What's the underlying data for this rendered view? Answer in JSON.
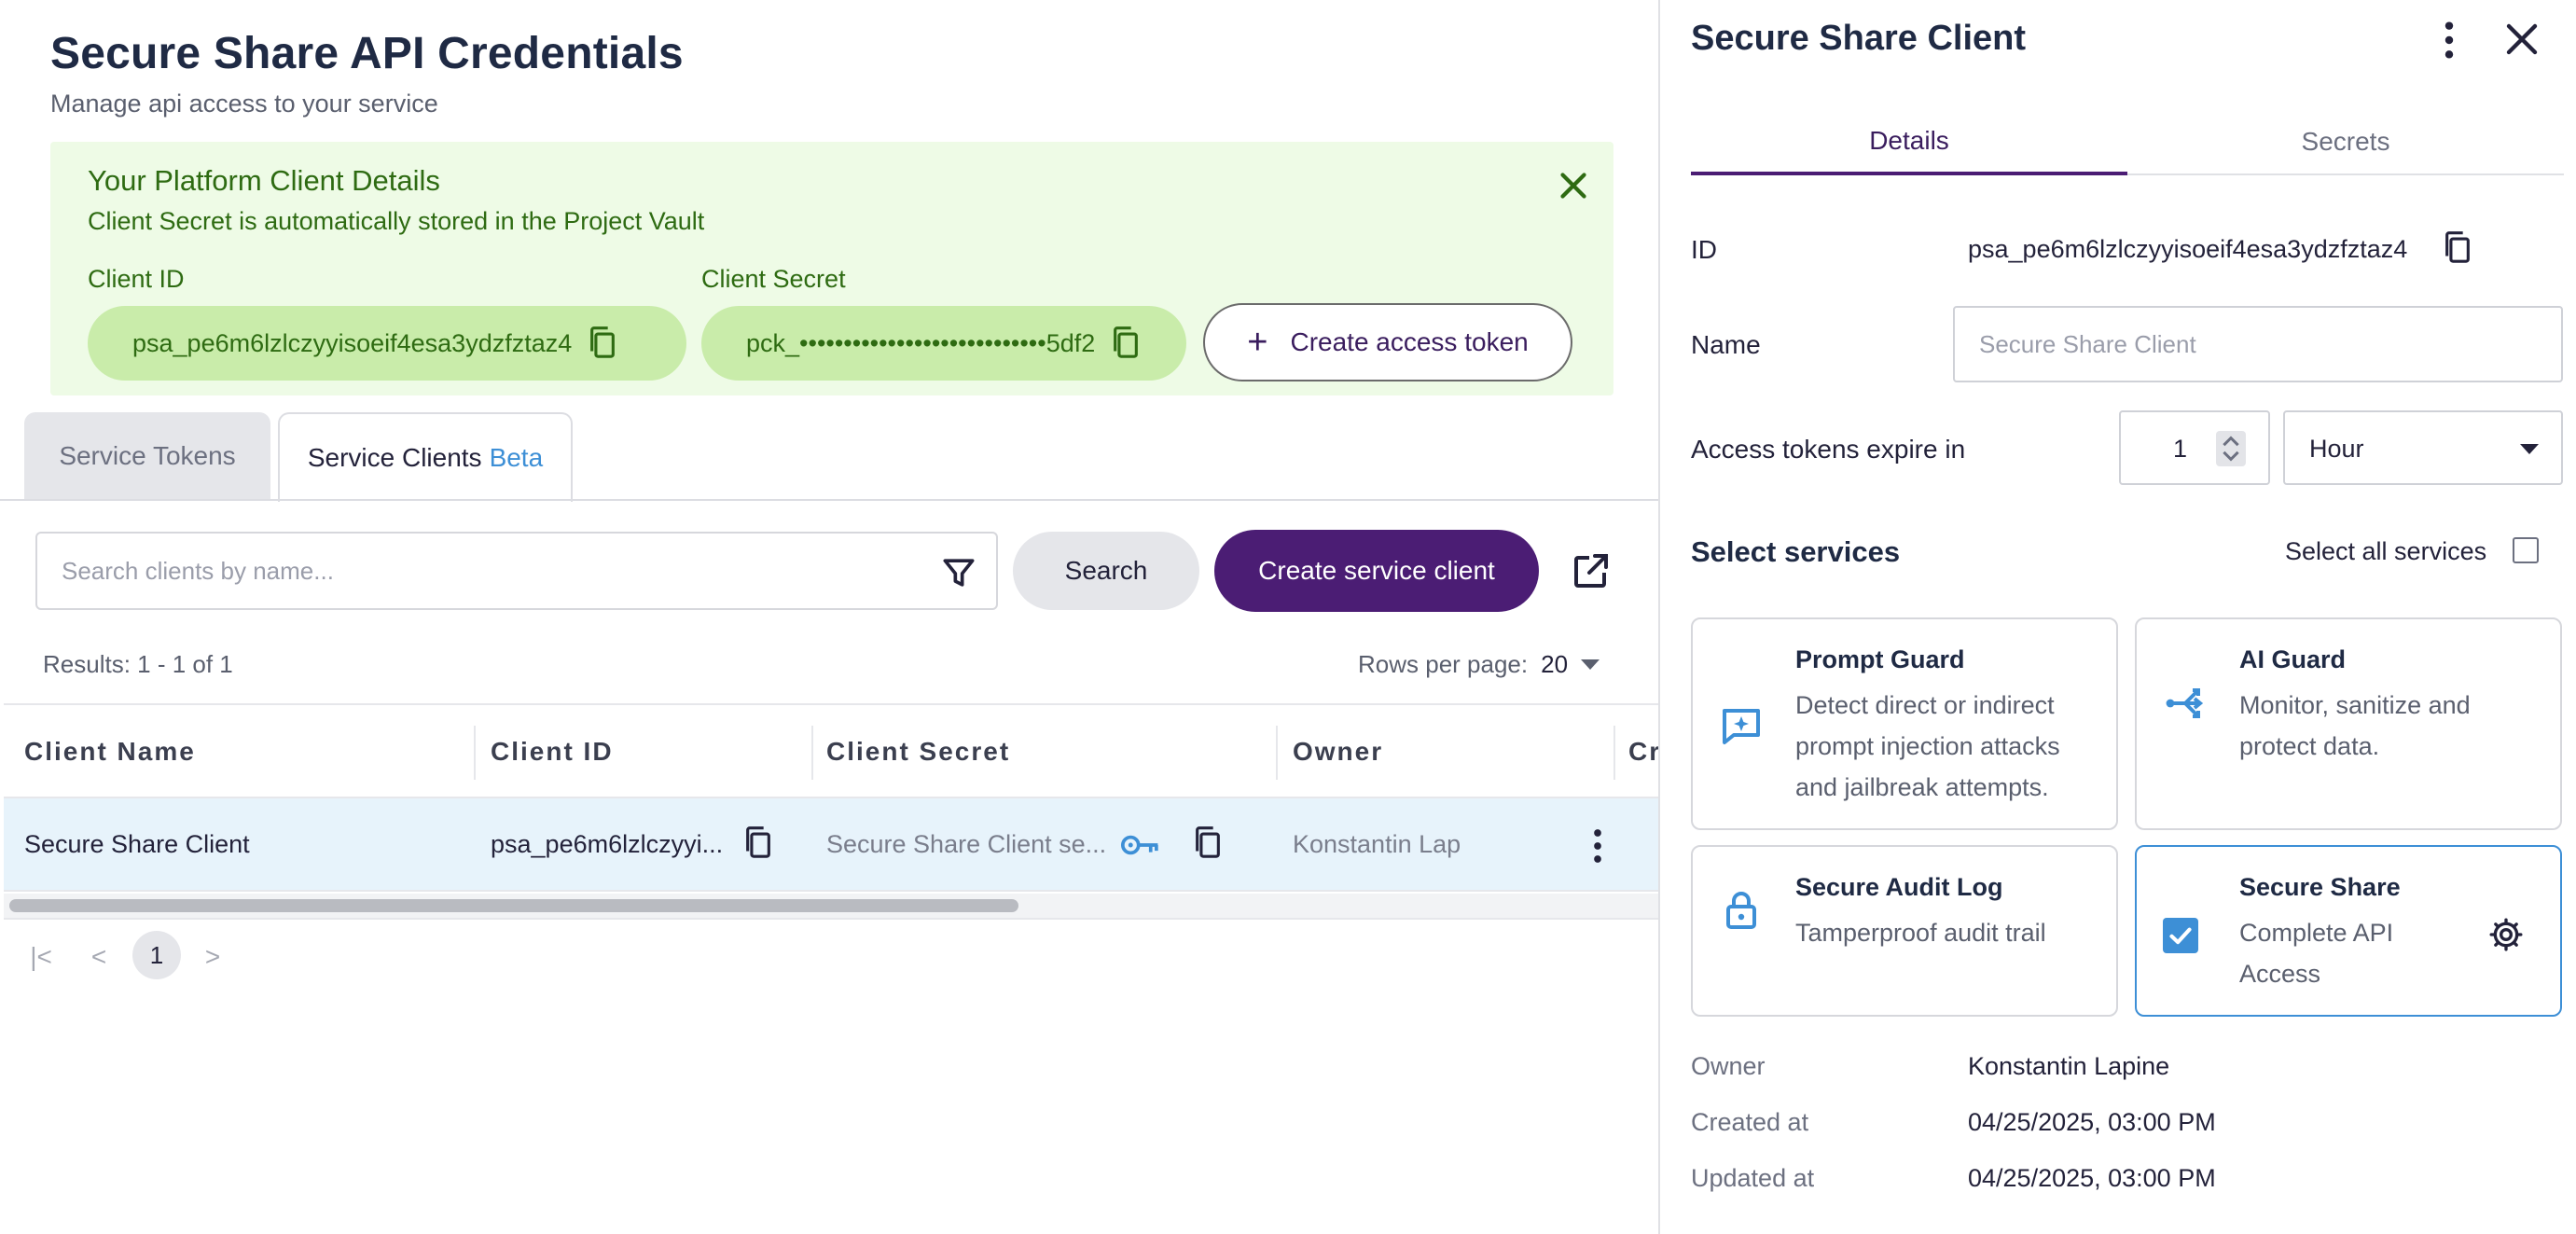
{
  "main": {
    "title": "Secure Share API Credentials",
    "subtitle": "Manage api access to your service",
    "notice": {
      "title": "Your Platform Client Details",
      "subtitle": "Client Secret is automatically stored in the Project Vault",
      "client_id_label": "Client ID",
      "client_id_value": "psa_pe6m6lzlczyyisoeif4esa3ydzfztaz4",
      "client_secret_label": "Client Secret",
      "client_secret_value": "pck_••••••••••••••••••••••••••••5df2",
      "create_token_label": "Create access token"
    },
    "tabs": [
      {
        "label": "Service Tokens"
      },
      {
        "label": "Service Clients",
        "badge": "Beta"
      }
    ],
    "search": {
      "placeholder": "Search clients by name...",
      "button": "Search"
    },
    "create_client_button": "Create service client",
    "results": "Results: 1 - 1 of 1",
    "rows_per_page_label": "Rows per page:",
    "rows_per_page_value": "20",
    "table": {
      "columns": [
        "Client Name",
        "Client ID",
        "Client Secret",
        "Owner",
        "Cr"
      ],
      "rows": [
        {
          "name": "Secure Share Client",
          "client_id": "psa_pe6m6lzlczyyi...",
          "client_secret": "Secure Share Client se...",
          "owner": "Konstantin Lap"
        }
      ]
    },
    "pagination": {
      "first": "|<",
      "prev": "<",
      "current": "1",
      "next": ">"
    }
  },
  "panel": {
    "title": "Secure Share Client",
    "tabs": [
      "Details",
      "Secrets"
    ],
    "id_label": "ID",
    "id_value": "psa_pe6m6lzlczyyisoeif4esa3ydzfztaz4",
    "name_label": "Name",
    "name_placeholder": "Secure Share Client",
    "expire_label": "Access tokens expire in",
    "expire_value": "1",
    "expire_unit": "Hour",
    "select_services_title": "Select services",
    "select_all_label": "Select all services",
    "services": [
      {
        "title": "Prompt Guard",
        "desc": "Detect direct or indirect prompt injection attacks and jailbreak attempts.",
        "icon": "chat-sparkle-icon"
      },
      {
        "title": "AI Guard",
        "desc": "Monitor, sanitize and protect data.",
        "icon": "branch-arrows-icon"
      },
      {
        "title": "Secure Audit Log",
        "desc": "Tamperproof audit trail",
        "icon": "lock-icon"
      },
      {
        "title": "Secure Share",
        "desc": "Complete API Access",
        "icon": "checkbox-checked-icon",
        "selected": true
      }
    ],
    "owner_label": "Owner",
    "owner_value": "Konstantin Lapine",
    "created_label": "Created at",
    "created_value": "04/25/2025, 03:00 PM",
    "updated_label": "Updated at",
    "updated_value": "04/25/2025, 03:00 PM"
  },
  "colors": {
    "primary": "#4b1d74",
    "accent_blue": "#3d8fd6",
    "success_bg": "#eefbe6",
    "success_text": "#2e6b12",
    "pill_green": "#c9ecaa",
    "row_selected": "#e7f3fb"
  }
}
